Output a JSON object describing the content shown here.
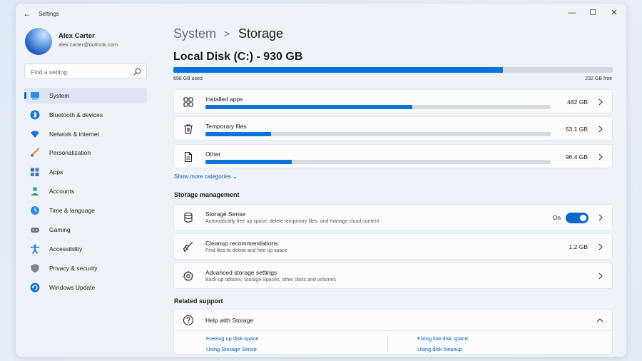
{
  "window": {
    "app_title": "Settings",
    "back_glyph": "←",
    "minimize_glyph": "—",
    "maximize_glyph": "☐",
    "close_glyph": "✕"
  },
  "user": {
    "name": "Alex Carter",
    "email": "alex.carter@outlook.com"
  },
  "search": {
    "placeholder": "Find a setting",
    "icon": "search-icon"
  },
  "sidebar": {
    "items": [
      {
        "label": "System",
        "icon": "system-monitor-icon",
        "active": true
      },
      {
        "label": "Bluetooth & devices",
        "icon": "bluetooth-icon"
      },
      {
        "label": "Network & internet",
        "icon": "wifi-icon"
      },
      {
        "label": "Personalization",
        "icon": "brush-icon"
      },
      {
        "label": "Apps",
        "icon": "apps-icon"
      },
      {
        "label": "Accounts",
        "icon": "person-icon"
      },
      {
        "label": "Time & language",
        "icon": "globe-clock-icon"
      },
      {
        "label": "Gaming",
        "icon": "gamepad-icon"
      },
      {
        "label": "Accessibility",
        "icon": "accessibility-icon"
      },
      {
        "label": "Privacy & security",
        "icon": "shield-icon"
      },
      {
        "label": "Windows Update",
        "icon": "update-icon"
      }
    ]
  },
  "breadcrumb": {
    "parent": "System",
    "separator": ">",
    "current": "Storage"
  },
  "disk": {
    "title": "Local Disk (C:) - 930 GB",
    "used_label": "698 GB used",
    "free_label": "232 GB free",
    "used_fraction": 0.75
  },
  "categories": [
    {
      "label": "Installed apps",
      "value": "482 GB",
      "fraction": 0.6,
      "icon": "apps-grid-icon"
    },
    {
      "label": "Temporary files",
      "value": "53.1 GB",
      "fraction": 0.19,
      "icon": "trash-icon"
    },
    {
      "label": "Other",
      "value": "96.4 GB",
      "fraction": 0.25,
      "icon": "document-icon"
    }
  ],
  "show_more": "Show more categories",
  "show_more_chevron": "⌄",
  "storage_management": {
    "heading": "Storage management",
    "items": [
      {
        "title": "Storage Sense",
        "subtitle": "Automatically free up space, delete temporary files, and manage cloud content",
        "toggle_label": "On",
        "toggle_on": true,
        "icon": "database-icon"
      },
      {
        "title": "Cleanup recommendations",
        "subtitle": "Find files to delete and free up space",
        "value": "1.2 GB",
        "icon": "broom-icon"
      },
      {
        "title": "Advanced storage settings",
        "subtitle": "Back up options, Storage Spaces, other disks and volumes",
        "icon": "gear-icon"
      }
    ]
  },
  "related_support": {
    "heading": "Related support",
    "help_title": "Help with Storage",
    "links": [
      "Freeing up disk space",
      "Using Storage Sense",
      "Fixing low disk space",
      "Using disk cleanup"
    ]
  },
  "colors": {
    "accent": "#0b74d6",
    "bar_track": "#d3dae4",
    "link": "#0a5fb8"
  }
}
